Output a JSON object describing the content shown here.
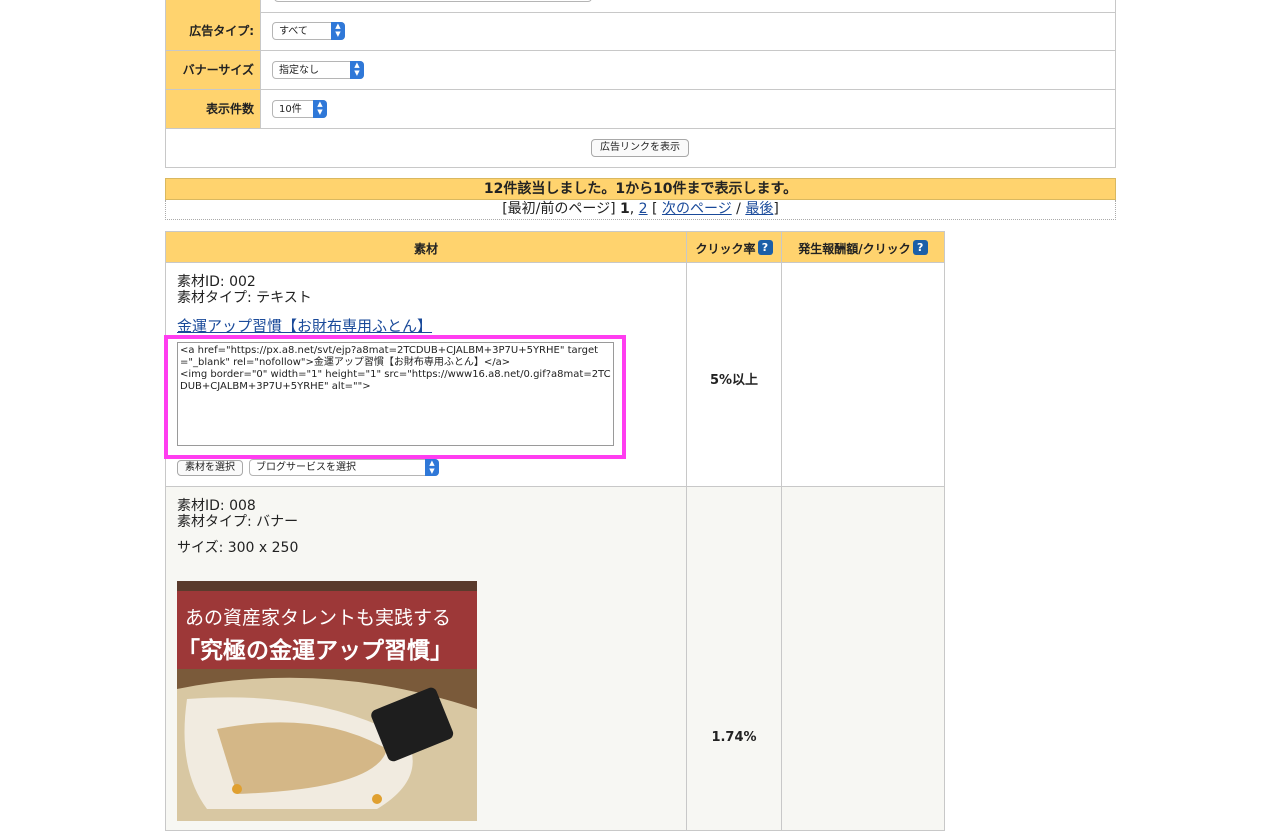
{
  "filters": {
    "ad_type_label": "広告タイプ:",
    "ad_type_value": "すべて",
    "banner_size_label": "バナーサイズ",
    "banner_size_value": "指定なし",
    "count_label": "表示件数",
    "count_value": "10件",
    "show_button": "広告リンクを表示"
  },
  "results": {
    "summary": "12件該当しました。1から10件まで表示します。",
    "pager_prefix": "[最初/前のページ] ",
    "current_page": "1",
    "page2": "2",
    "next": "次のページ",
    "last": "最後",
    "separator_open": " [ ",
    "separator_mid": " / ",
    "separator_close": "]"
  },
  "table": {
    "col_material": "素材",
    "col_ctr": "クリック率",
    "col_reward": "発生報酬額/クリック",
    "help_glyph": "?"
  },
  "rows": [
    {
      "id_line": "素材ID: 002",
      "type_line": "素材タイプ: テキスト",
      "link_text": "金運アップ習慣【お財布専用ふとん】",
      "code": "<a href=\"https://px.a8.net/svt/ejp?a8mat=2TCDUB+CJALBM+3P7U+5YRHE\" target=\"_blank\" rel=\"nofollow\">金運アップ習慣【お財布専用ふとん】</a>\n<img border=\"0\" width=\"1\" height=\"1\" src=\"https://www16.a8.net/0.gif?a8mat=2TCDUB+CJALBM+3P7U+5YRHE\" alt=\"\">",
      "select_button": "素材を選択",
      "blog_select": "ブログサービスを選択",
      "ctr": "5%以上"
    },
    {
      "id_line": "素材ID: 008",
      "type_line": "素材タイプ: バナー",
      "size_line": "サイズ: 300 x 250",
      "banner_line1": "あの資産家タレントも実践する",
      "banner_line2": "「究極の金運アップ習慣」",
      "ctr": "1.74%"
    }
  ]
}
